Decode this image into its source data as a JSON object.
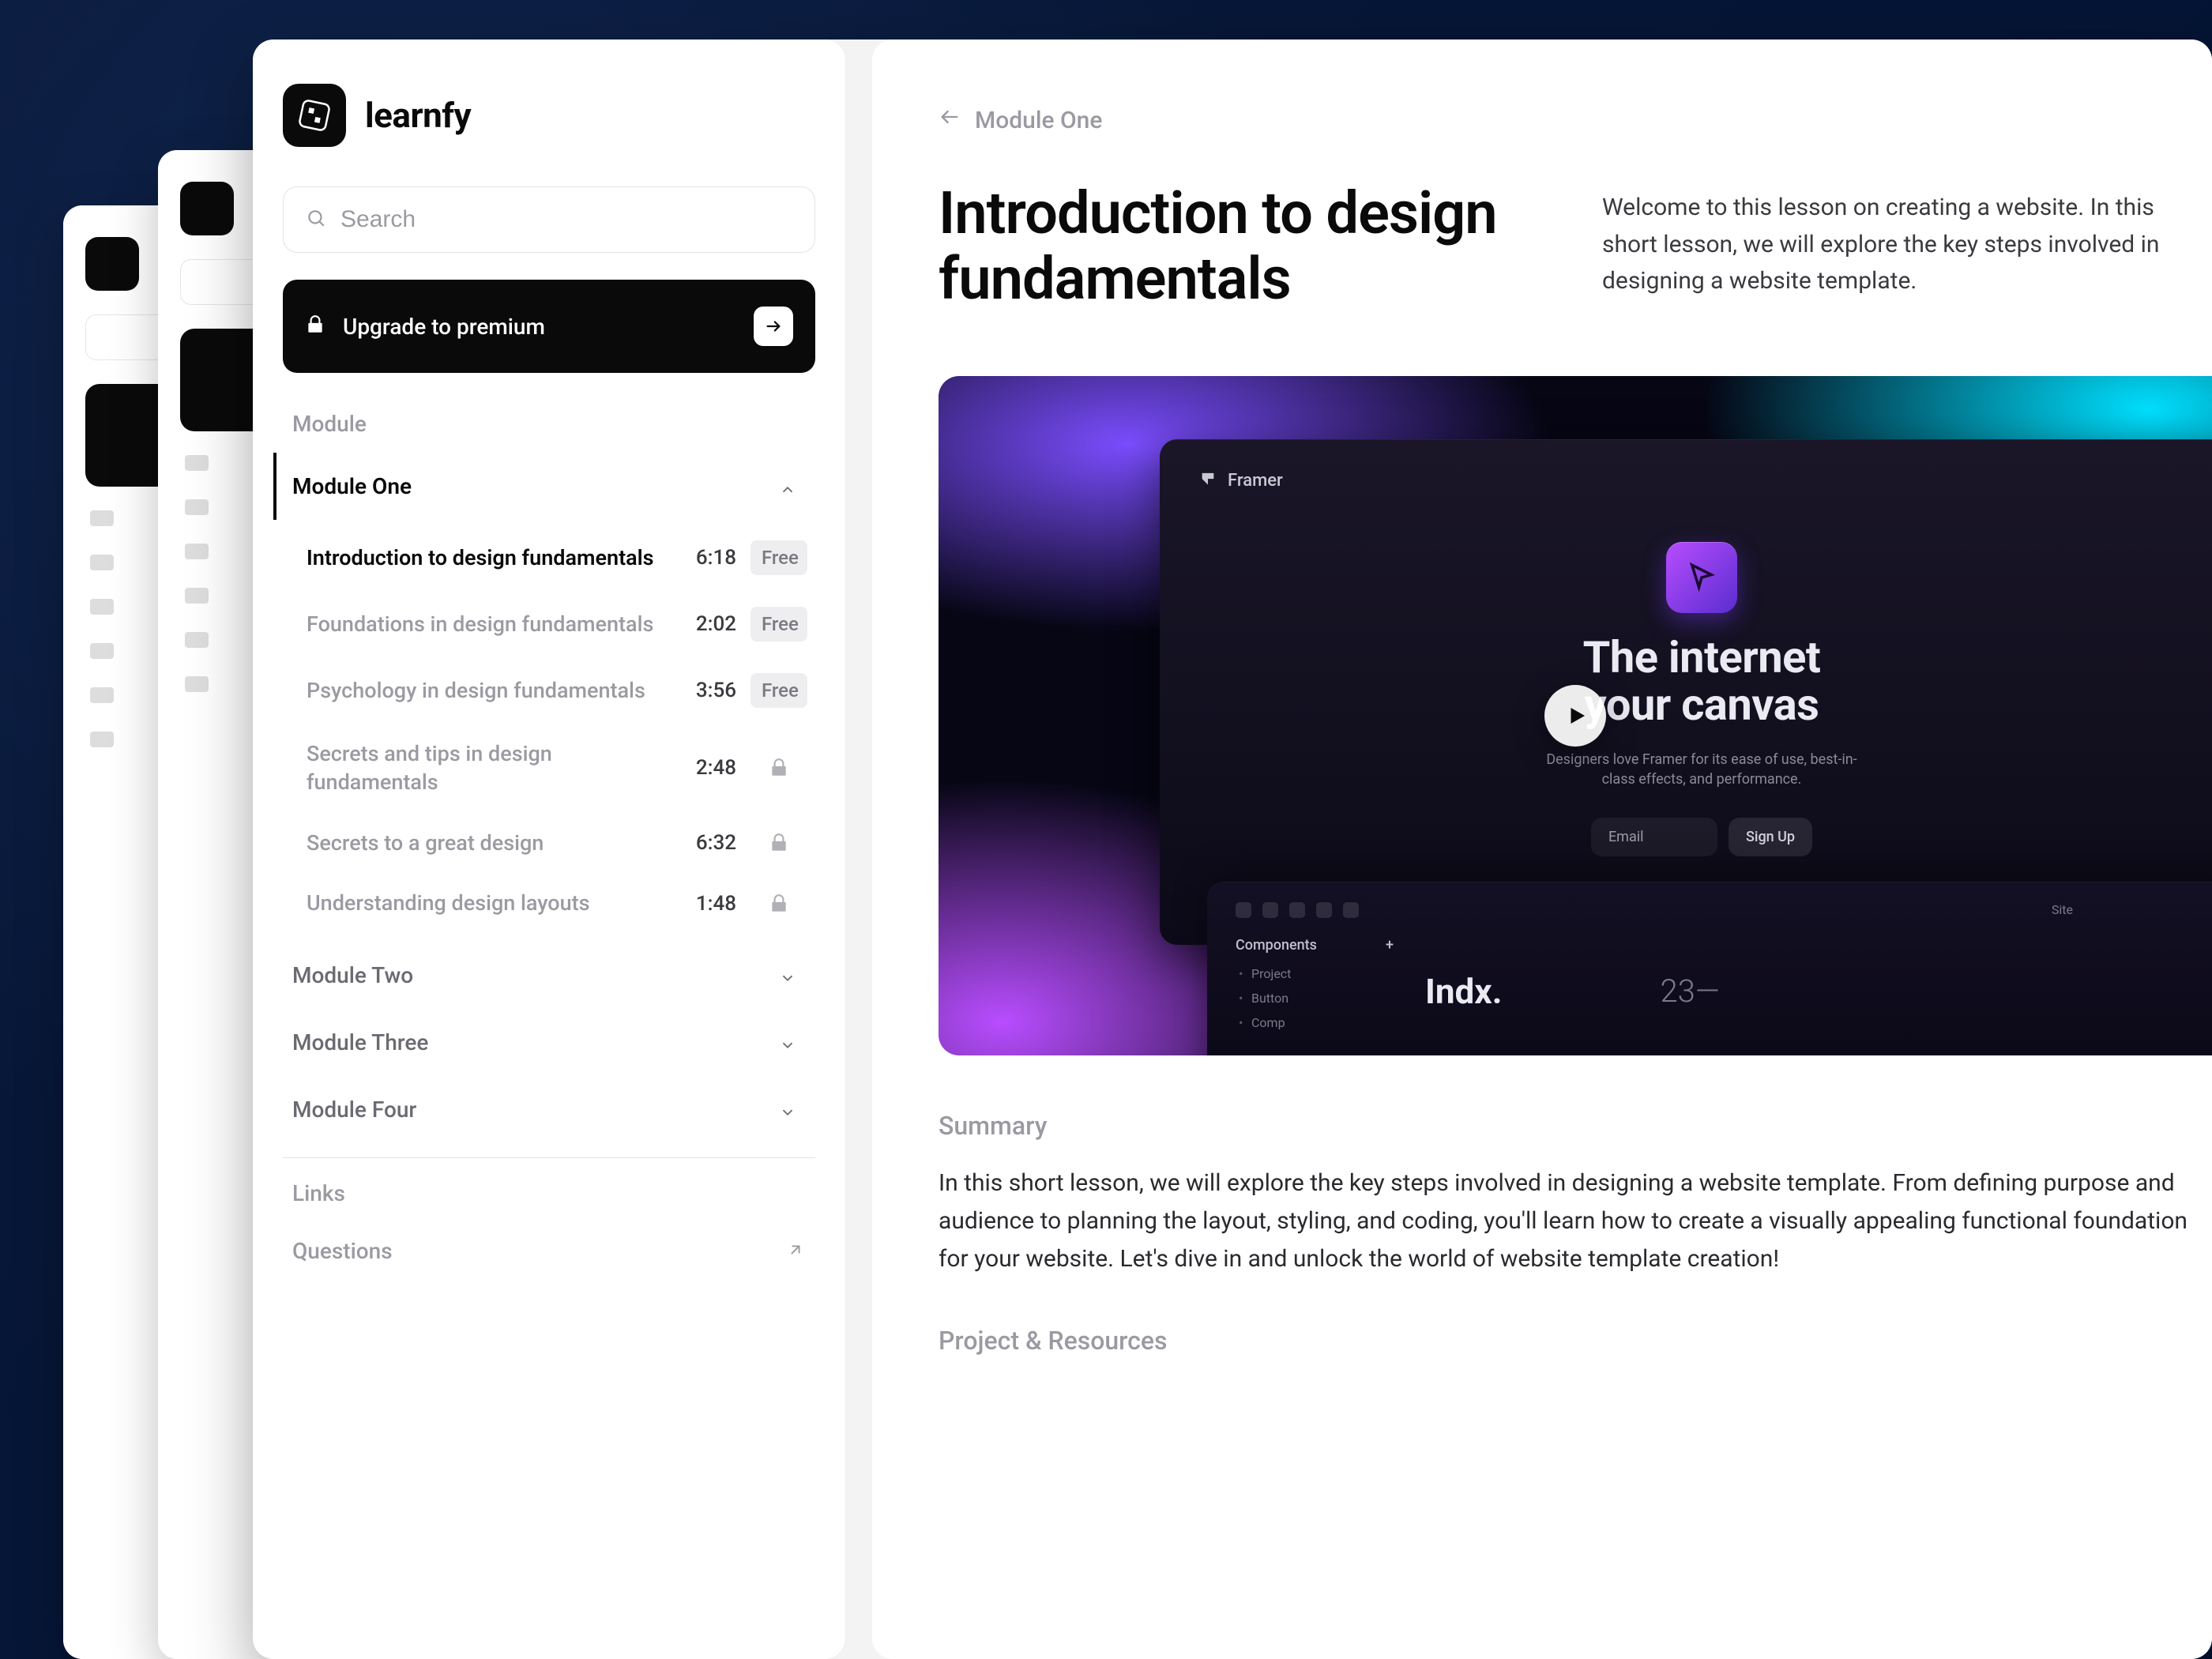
{
  "brand": {
    "name": "learnfy"
  },
  "search": {
    "placeholder": "Search"
  },
  "upgrade": {
    "label": "Upgrade to premium"
  },
  "module_section_label": "Module",
  "modules": [
    {
      "name": "Module One",
      "expanded": true
    },
    {
      "name": "Module Two",
      "expanded": false
    },
    {
      "name": "Module Three",
      "expanded": false
    },
    {
      "name": "Module Four",
      "expanded": false
    }
  ],
  "lessons": [
    {
      "title": "Introduction to design fundamentals",
      "time": "6:18",
      "badge": "Free",
      "active": true,
      "locked": false
    },
    {
      "title": "Foundations in design fundamentals",
      "time": "2:02",
      "badge": "Free",
      "active": false,
      "locked": false
    },
    {
      "title": "Psychology in design fundamentals",
      "time": "3:56",
      "badge": "Free",
      "active": false,
      "locked": false
    },
    {
      "title": "Secrets and tips in design fundamentals",
      "time": "2:48",
      "badge": null,
      "active": false,
      "locked": true
    },
    {
      "title": "Secrets to a great design",
      "time": "6:32",
      "badge": null,
      "active": false,
      "locked": true
    },
    {
      "title": "Understanding design layouts",
      "time": "1:48",
      "badge": null,
      "active": false,
      "locked": true
    }
  ],
  "links_section_label": "Links",
  "links": [
    {
      "label": "Questions"
    }
  ],
  "breadcrumb": {
    "label": "Module One"
  },
  "lesson_page": {
    "title": "Introduction to design fundamentals",
    "intro": "Welcome to this lesson on creating a website. In this short lesson, we will explore the key steps involved in designing a website template.",
    "summary_label": "Summary",
    "summary": "In this short lesson, we will explore the key steps involved in designing a website template. From defining purpose and audience to planning the layout, styling, and coding, you'll learn how to create a visually appealing functional foundation for your website. Let's dive in and unlock the world of website template creation!",
    "resources_label": "Project & Resources"
  },
  "video_preview": {
    "brand": "Framer",
    "headline_line1": "The internet",
    "headline_line2": "your canvas",
    "sub": "Designers love Framer for its ease of use, best-in-class effects, and performance.",
    "email_placeholder": "Email",
    "signup_label": "Sign Up",
    "lower": {
      "site_label": "Site",
      "panel_title": "Components",
      "panel_items": [
        "Project",
        "Button",
        "Comp"
      ],
      "indx": "Indx.",
      "num": "23—"
    }
  }
}
